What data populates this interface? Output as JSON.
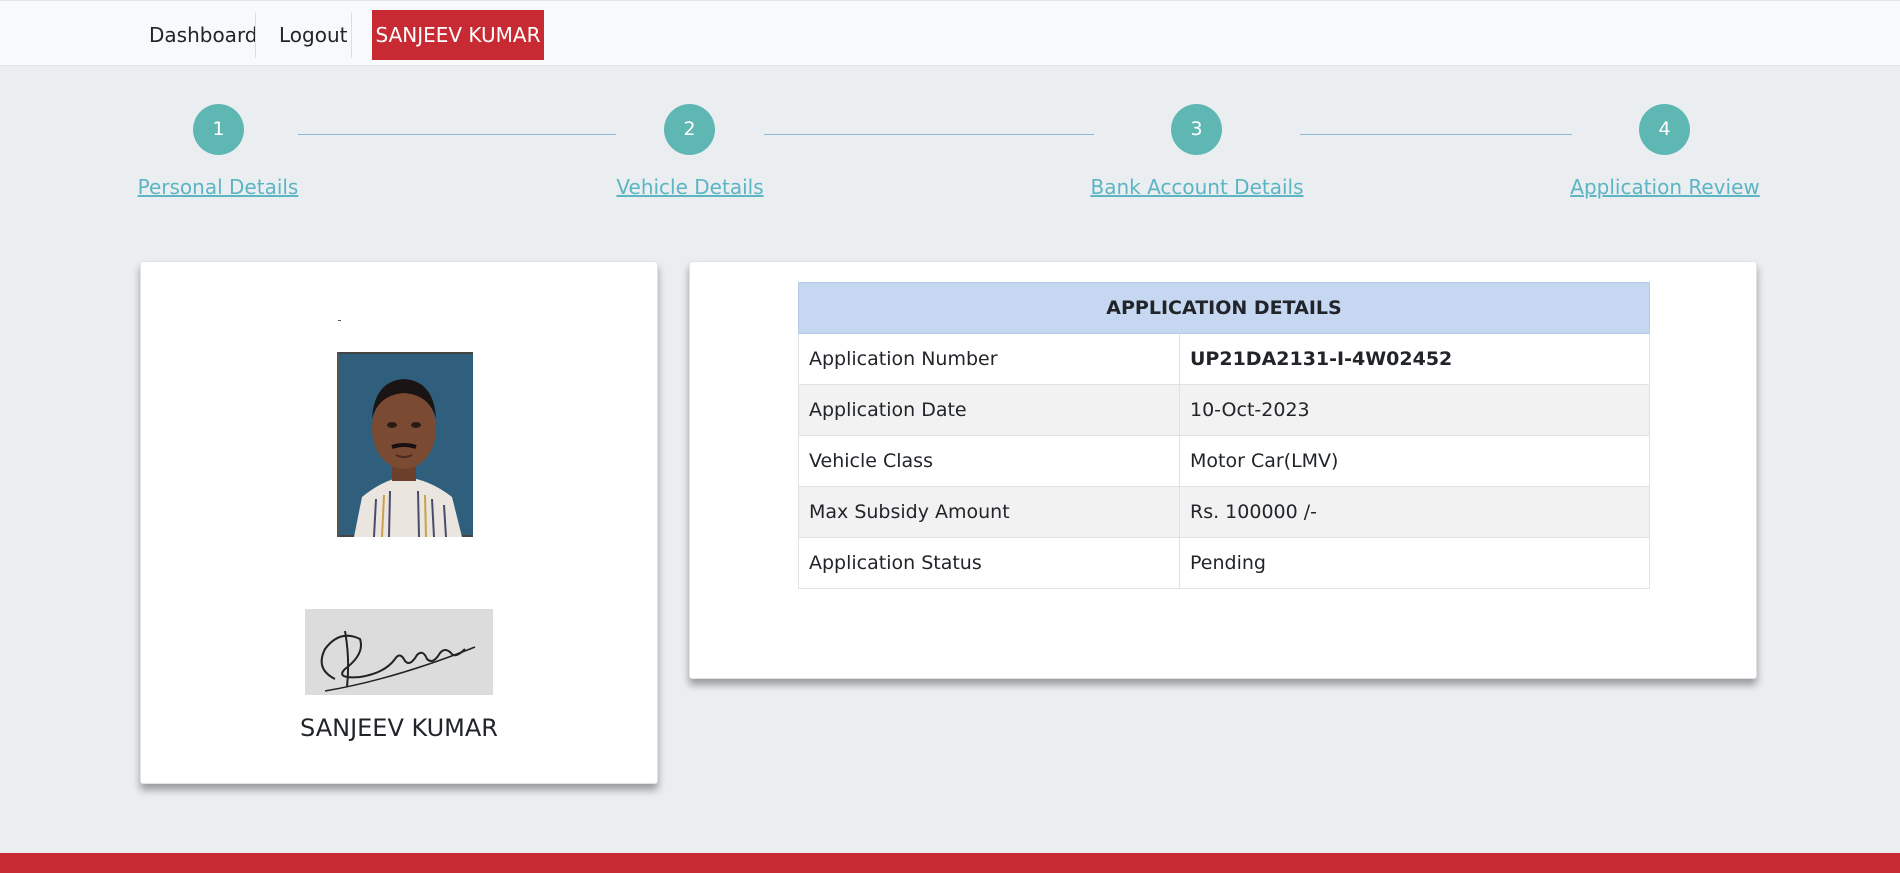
{
  "navbar": {
    "dashboard_label": "Dashboard",
    "logout_label": "Logout",
    "user_label": "SANJEEV KUMAR"
  },
  "stepper": {
    "steps": [
      {
        "number": "1",
        "label": "Personal Details"
      },
      {
        "number": "2",
        "label": "Vehicle Details"
      },
      {
        "number": "3",
        "label": "Bank Account Details"
      },
      {
        "number": "4",
        "label": "Application Review"
      }
    ]
  },
  "profile": {
    "name": "SANJEEV KUMAR"
  },
  "application": {
    "title": "APPLICATION DETAILS",
    "rows": [
      {
        "label": "Application Number",
        "value": "UP21DA2131-I-4W02452"
      },
      {
        "label": "Application Date",
        "value": "10-Oct-2023"
      },
      {
        "label": "Vehicle Class",
        "value": "Motor Car(LMV)"
      },
      {
        "label": "Max Subsidy Amount",
        "value": "Rs. 100000 /-"
      },
      {
        "label": "Application Status",
        "value": "Pending"
      }
    ]
  },
  "colors": {
    "brand_red": "#c82a33",
    "step_teal": "#5fb7b4",
    "table_header": "#c6d7f2"
  }
}
